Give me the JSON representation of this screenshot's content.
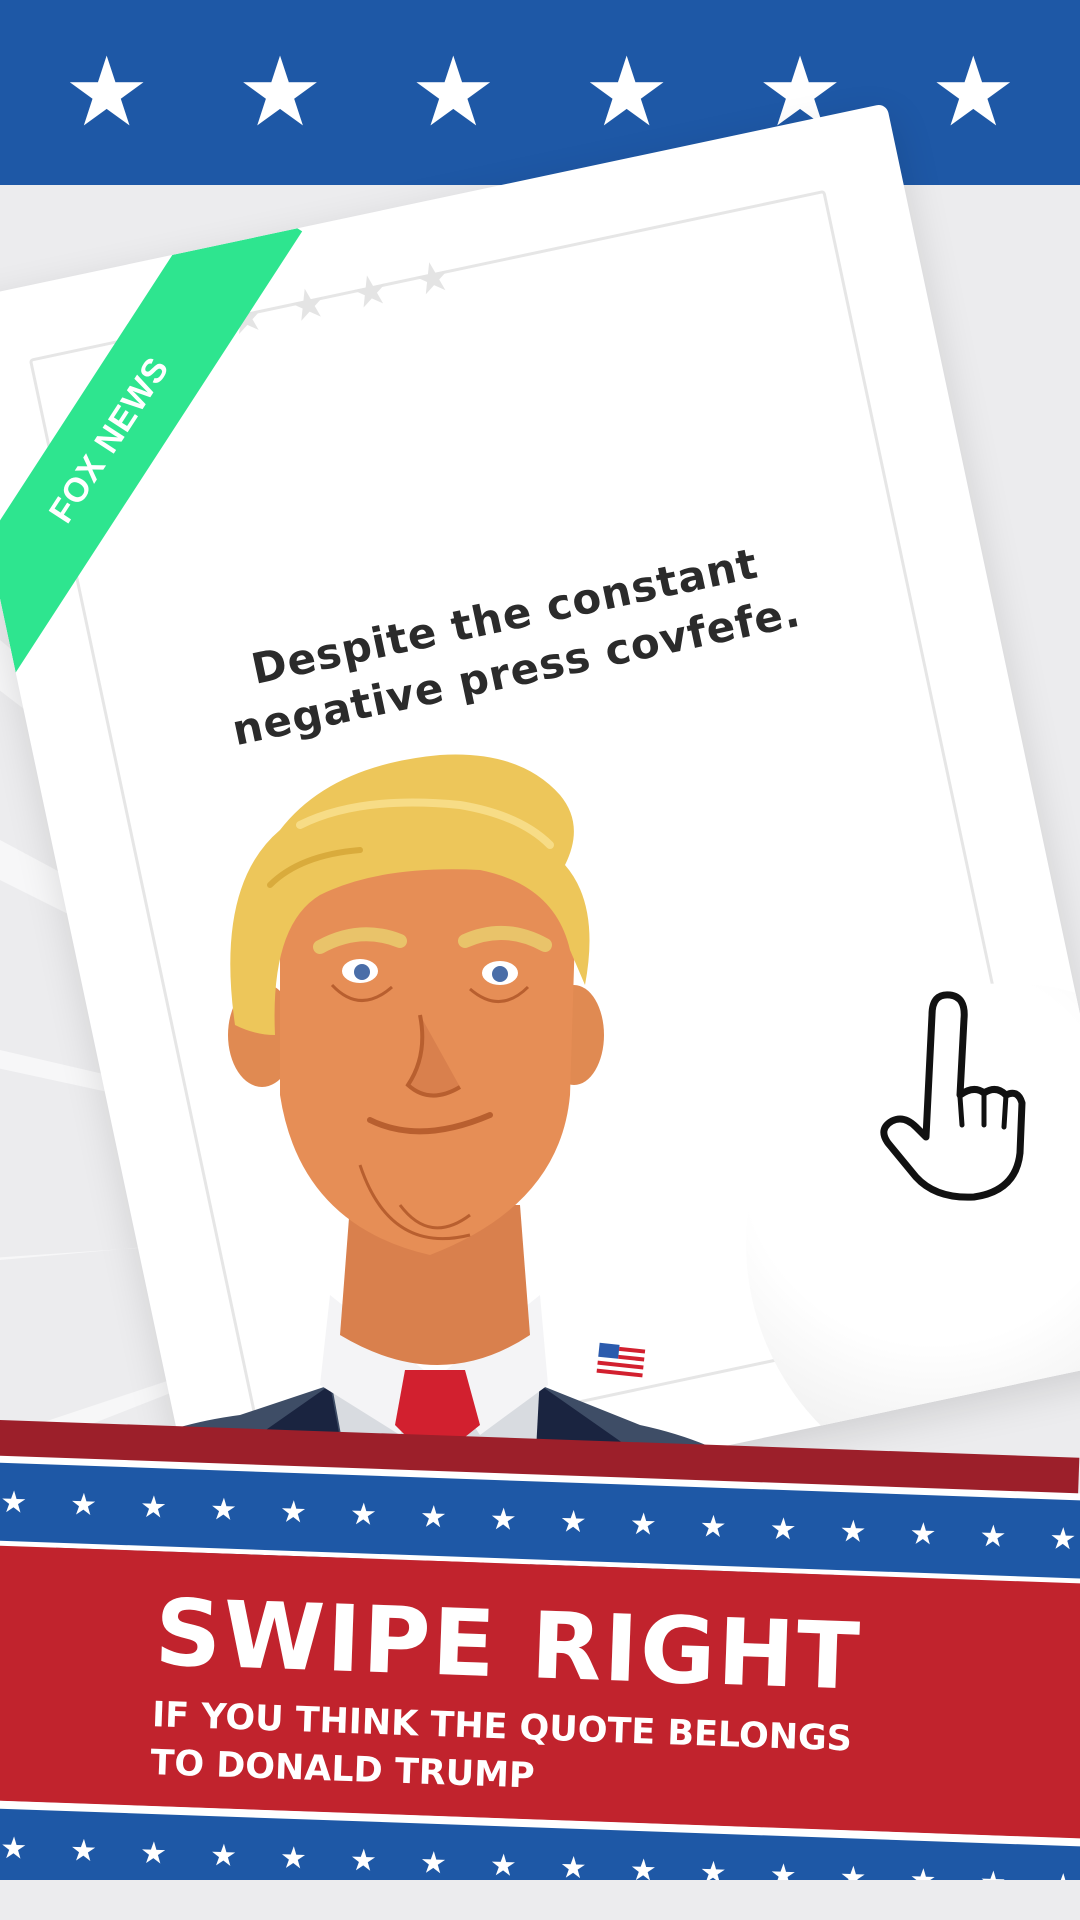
{
  "card": {
    "ribbon_label": "FOX NEWS",
    "quote_line1": "Despite the constant",
    "quote_line2": "negative press covfefe."
  },
  "banner": {
    "title": "SWIPE RIGHT",
    "subtitle_line1": "IF YOU THINK THE QUOTE BELONGS",
    "subtitle_line2": "TO DONALD TRUMP"
  },
  "gesture_hint": {
    "icon": "pointing-hand-icon",
    "direction": "right"
  },
  "colors": {
    "flag_blue": "#1e58a6",
    "flag_red": "#c1232d",
    "dark_red": "#9c1f2a",
    "ribbon_green": "#2ee58f",
    "background": "#ececee"
  }
}
